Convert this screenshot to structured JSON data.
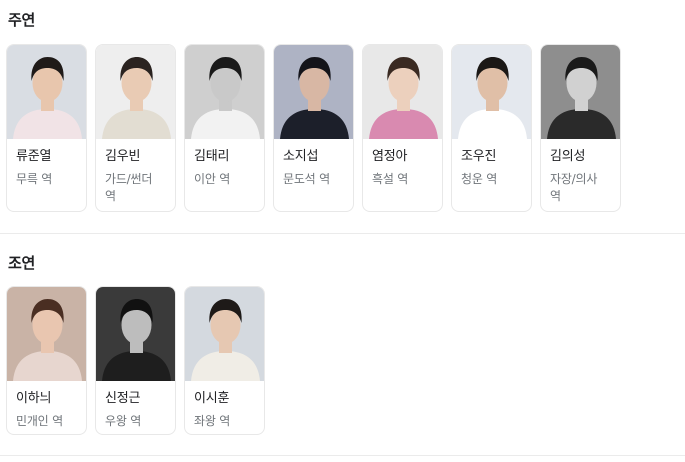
{
  "lead": {
    "title": "주연",
    "cast": [
      {
        "name": "류준열",
        "role": "무륵 역",
        "photo": {
          "bg": "#d9dde3",
          "skin": "#e8c6ad",
          "hair": "#1f1a18",
          "cloth": "#f1e3e6"
        }
      },
      {
        "name": "김우빈",
        "role": "가드/썬더 역",
        "photo": {
          "bg": "#eeeeee",
          "skin": "#e9cbb4",
          "hair": "#2a2320",
          "cloth": "#e2ddd2"
        }
      },
      {
        "name": "김태리",
        "role": "이안 역",
        "photo": {
          "bg": "#cfcfcf",
          "skin": "#c9c9c9",
          "hair": "#1a1a1a",
          "cloth": "#f2f2f2"
        }
      },
      {
        "name": "소지섭",
        "role": "문도석 역",
        "photo": {
          "bg": "#aeb3c4",
          "skin": "#d8b7a4",
          "hair": "#14141a",
          "cloth": "#1c1f2a"
        }
      },
      {
        "name": "염정아",
        "role": "흑설 역",
        "photo": {
          "bg": "#e8e8e8",
          "skin": "#ecd0bd",
          "hair": "#3a2a22",
          "cloth": "#d98ab0"
        }
      },
      {
        "name": "조우진",
        "role": "청운 역",
        "photo": {
          "bg": "#e4e8ee",
          "skin": "#e0bfa7",
          "hair": "#1b1816",
          "cloth": "#ffffff"
        }
      },
      {
        "name": "김의성",
        "role": "자장/의사 역",
        "photo": {
          "bg": "#8e8e8e",
          "skin": "#d1d1d1",
          "hair": "#1a1a1a",
          "cloth": "#2a2a2a"
        }
      }
    ]
  },
  "support": {
    "title": "조연",
    "cast": [
      {
        "name": "이하늬",
        "role": "민개인 역",
        "photo": {
          "bg": "#c9b3a6",
          "skin": "#e9c6b0",
          "hair": "#4a2e22",
          "cloth": "#e7d6cf"
        }
      },
      {
        "name": "신정근",
        "role": "우왕 역",
        "photo": {
          "bg": "#3a3a3a",
          "skin": "#bdbdbd",
          "hair": "#111111",
          "cloth": "#1e1e1e"
        }
      },
      {
        "name": "이시훈",
        "role": "좌왕 역",
        "photo": {
          "bg": "#d4d9df",
          "skin": "#e6c8b2",
          "hair": "#1e1a18",
          "cloth": "#f0ede6"
        }
      }
    ]
  }
}
